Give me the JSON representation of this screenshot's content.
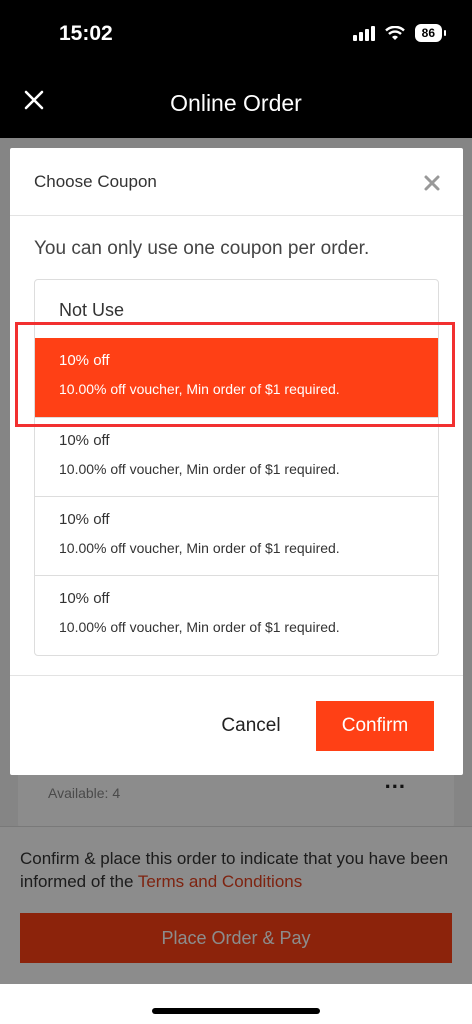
{
  "status": {
    "time": "15:02",
    "battery": "86"
  },
  "nav": {
    "title": "Online Order"
  },
  "background": {
    "available": "Available: 4",
    "more": "...",
    "footer_text": "Confirm & place this order to indicate that you have been informed of the ",
    "terms_link": "Terms and Conditions",
    "place_order": "Place Order & Pay"
  },
  "modal": {
    "title": "Choose Coupon",
    "hint": "You can only use one coupon per order.",
    "not_use": "Not Use",
    "coupons": [
      {
        "title": "10% off",
        "desc": "10.00% off voucher, Min order of $1 required.",
        "selected": true
      },
      {
        "title": "10% off",
        "desc": "10.00% off voucher, Min order of $1 required.",
        "selected": false
      },
      {
        "title": "10% off",
        "desc": "10.00% off voucher, Min order of $1 required.",
        "selected": false
      },
      {
        "title": "10% off",
        "desc": "10.00% off voucher, Min order of $1 required.",
        "selected": false
      }
    ],
    "cancel": "Cancel",
    "confirm": "Confirm"
  },
  "colors": {
    "accent": "#ff4015",
    "highlight": "#f23030"
  }
}
